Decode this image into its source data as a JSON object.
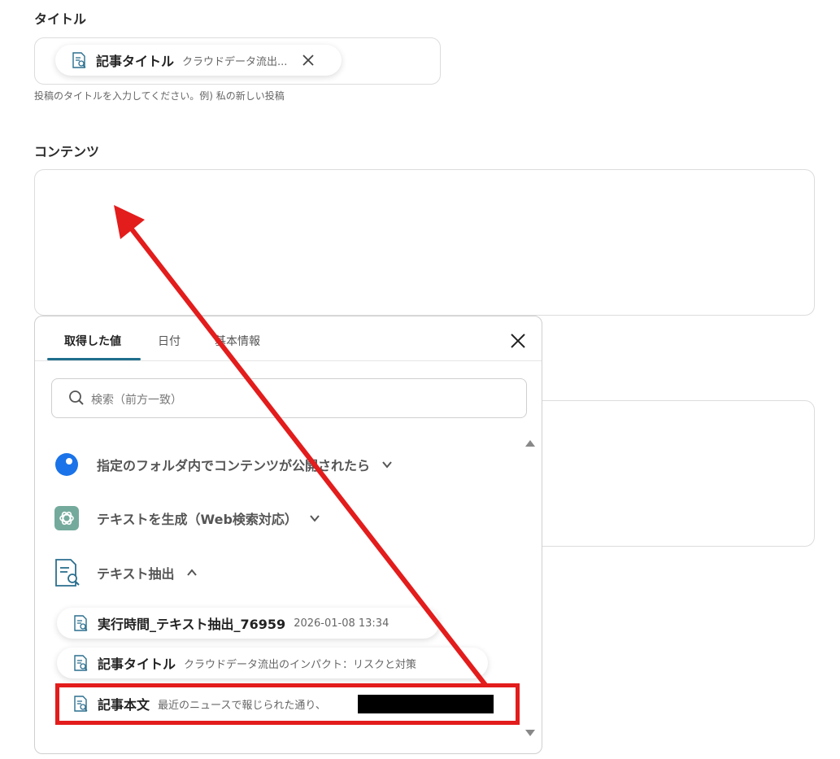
{
  "title_field": {
    "label": "タイトル",
    "chip_name": "記事タイトル",
    "chip_value": "クラウドデータ流出...",
    "hint": "投稿のタイトルを入力してください。例) 私の新しい投稿"
  },
  "content_field": {
    "label": "コンテンツ"
  },
  "panel": {
    "tabs": [
      "取得した値",
      "日付",
      "基本情報"
    ],
    "search_placeholder": "検索（前方一致）",
    "sections": [
      {
        "label": "指定のフォルダ内でコンテンツが公開されたら",
        "state": "collapsed"
      },
      {
        "label": "テキストを生成（Web検索対応）",
        "state": "collapsed"
      },
      {
        "label": "テキスト抽出",
        "state": "expanded"
      }
    ],
    "items": [
      {
        "name": "実行時間_テキスト抽出_76959",
        "value": "2026-01-08 13:34"
      },
      {
        "name": "記事タイトル",
        "value": "クラウドデータ流出のインパクト：リスクと対策"
      },
      {
        "name": "記事本文",
        "value": "最近のニュースで報じられた通り、"
      }
    ]
  },
  "colors": {
    "accent_tab": "#1f6e8c",
    "annotation_red": "#e31c1c",
    "blue_dot": "#1a73e8",
    "openai_green": "#74aa9c",
    "doc_icon": "#2b6f8e"
  }
}
